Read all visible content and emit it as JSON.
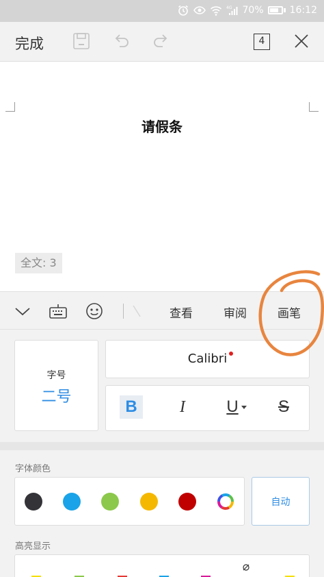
{
  "statusbar": {
    "battery_text": "70%",
    "battery_level": 0.7,
    "time": "16:12",
    "icons": [
      "alarm-icon",
      "eye-icon",
      "wifi-icon",
      "signal-4g-icon",
      "battery-icon"
    ]
  },
  "toolbar": {
    "done_label": "完成",
    "page_count": "4",
    "icons": [
      "save-icon",
      "undo-icon",
      "redo-icon",
      "page-count-icon",
      "close-icon"
    ]
  },
  "document": {
    "title": "请假条",
    "word_count": "全文: 3"
  },
  "edit_bar": {
    "tabs": [
      "查看",
      "审阅",
      "画笔"
    ],
    "icons": [
      "collapse-chevron-icon",
      "keyboard-icon",
      "emoji-icon",
      "pen-icon"
    ]
  },
  "font_panel": {
    "size_label": "字号",
    "size_value": "二号",
    "font_name": "Calibri",
    "styles": [
      {
        "label": "B",
        "active": true
      },
      {
        "label": "I",
        "active": false
      },
      {
        "label": "U",
        "active": false
      },
      {
        "label": "S",
        "active": false
      }
    ],
    "font_color_label": "字体颜色",
    "colors": [
      "#333338",
      "#1aa3e8",
      "#8cc84b",
      "#f5b800",
      "#c00000"
    ],
    "auto_label": "自动",
    "highlight_label": "高亮显示"
  },
  "annotation": {
    "color": "#e8853f"
  }
}
